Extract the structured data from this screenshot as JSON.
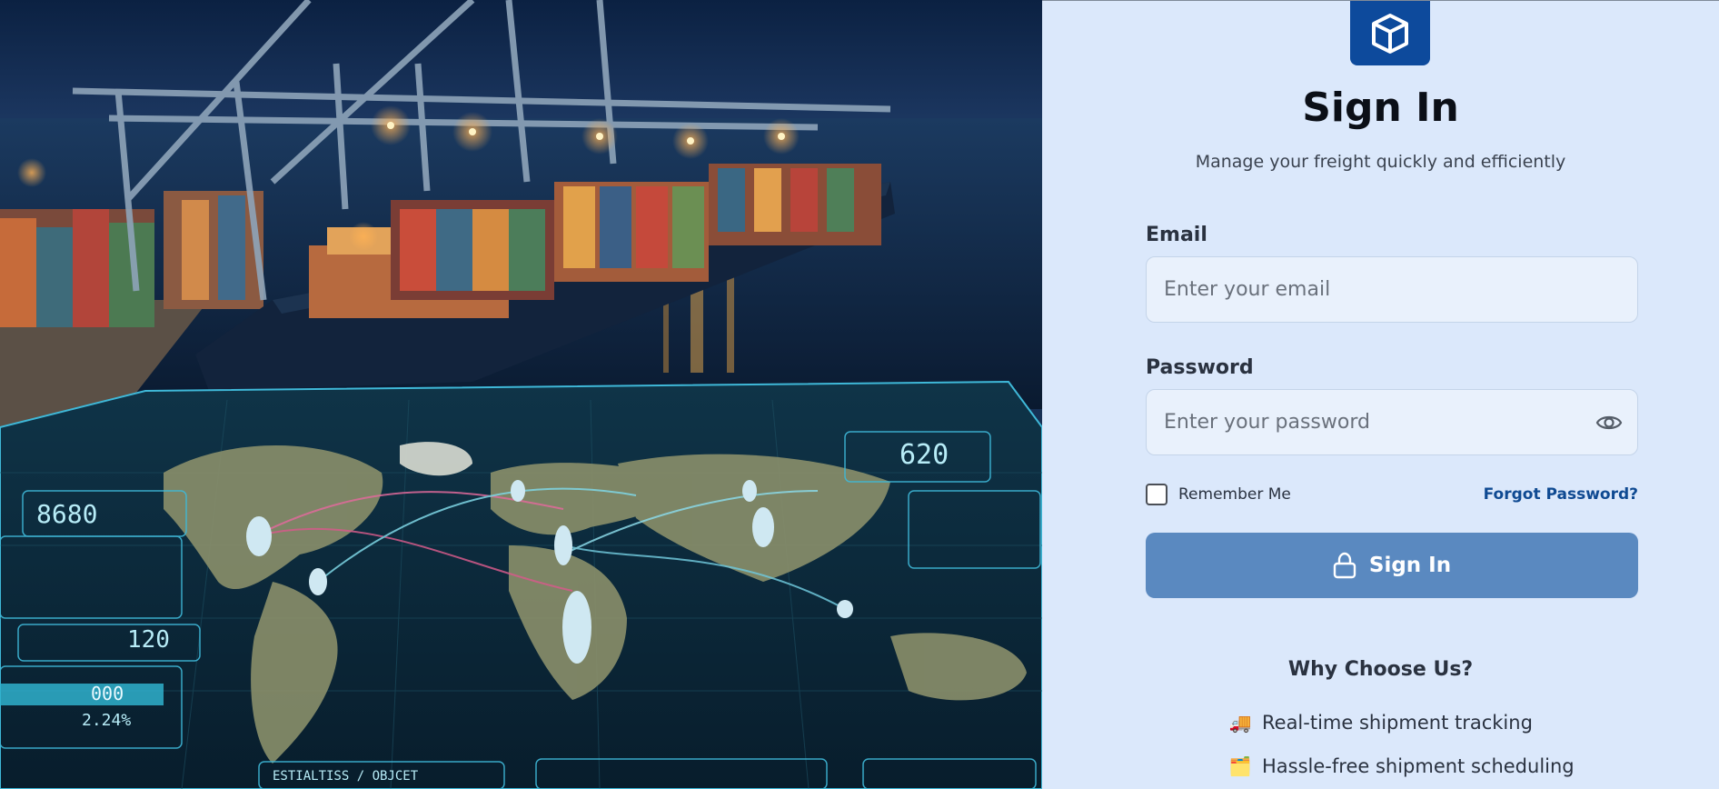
{
  "hero": {
    "image_description_icon": "cargo-port-dashboard-image",
    "readouts": [
      "8680",
      "620",
      "120",
      "000",
      "2.24%",
      "ESTIALTISS / OBJCET"
    ]
  },
  "signin": {
    "title": "Sign In",
    "subtitle": "Manage your freight quickly and efficiently",
    "email_label": "Email",
    "email_placeholder": "Enter your email",
    "password_label": "Password",
    "password_placeholder": "Enter your password",
    "remember_label": "Remember Me",
    "forgot_label": "Forgot Password?",
    "button_label": "Sign In"
  },
  "why": {
    "title": "Why Choose Us?",
    "features": [
      {
        "icon": "🚚",
        "text": "Real-time shipment tracking"
      },
      {
        "icon": "🗂️",
        "text": "Hassle-free shipment scheduling"
      }
    ]
  },
  "colors": {
    "brand": "#0d4a9c",
    "button": "#5a89c0",
    "panel_bg": "#dbe8fb",
    "link": "#0f4a92"
  }
}
